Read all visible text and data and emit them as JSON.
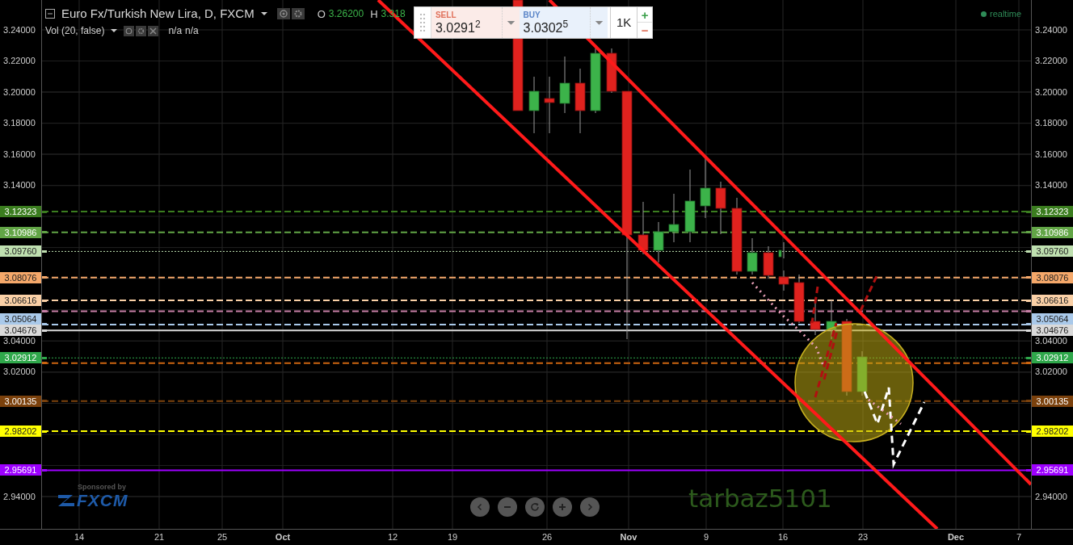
{
  "legend": {
    "title": "Euro Fx/Turkish New Lira, D, FXCM",
    "ohlc": [
      {
        "key": "O",
        "value": "3.26200"
      },
      {
        "key": "H",
        "value": "3.318"
      }
    ]
  },
  "volume_legend": {
    "title": "Vol (20, false)",
    "values": [
      "n/a",
      "n/a"
    ]
  },
  "trade_widget": {
    "sell": {
      "label": "SELL",
      "price": "3.0291$^{2}$"
    },
    "buy": {
      "label": "BUY",
      "price": "3.0302$^{5}$"
    },
    "quantity": "1K",
    "increase": "+",
    "decrease": "−"
  },
  "status": {
    "label": "realtime"
  },
  "left_price_axis": {
    "ticks": [
      "3.24000",
      "3.22000",
      "3.20000",
      "3.18000",
      "3.16000",
      "3.14000",
      "3.04000",
      "3.02000",
      "2.94000"
    ]
  },
  "right_price_axis": {
    "ticks": [
      "3.24000",
      "3.22000",
      "3.20000",
      "3.18000",
      "3.16000",
      "3.14000",
      "3.04000",
      "3.02000",
      "2.94000"
    ]
  },
  "price_levels": [
    {
      "left_label": "3.12323",
      "right_label": "3.12323",
      "color": "#3b7d1f",
      "kind": "dashed"
    },
    {
      "left_label": "3.10986",
      "right_label": "3.10986",
      "color": "#62a546",
      "kind": "dashed"
    },
    {
      "left_label": "3.09760",
      "right_label": "3.09760",
      "color": "#bfe0b0",
      "kind": "dotted"
    },
    {
      "left_label": "3.08076",
      "right_label": "3.08076",
      "color": "#f5a86a",
      "kind": "dashed"
    },
    {
      "left_label": "3.06616",
      "right_label": "3.06616",
      "color": "#fad0a6",
      "kind": "dashed"
    },
    {
      "color": "#c77fa6",
      "kind": "dashed"
    },
    {
      "left_label": "3.05064",
      "right_label": "3.05064",
      "color": "#a9c9ea",
      "kind": "dashed"
    },
    {
      "left_label": "3.04676",
      "right_label": "3.04676",
      "color": "#dadada",
      "kind": "solid"
    },
    {
      "left_label": "3.02912",
      "right_label": "3.02912",
      "color": "#2fa84b",
      "kind": "dotted"
    },
    {
      "color": "#cc6410",
      "kind": "dashed"
    },
    {
      "left_label": "3.00135",
      "right_label": "3.00135",
      "color": "#7b410c",
      "kind": "dashed"
    },
    {
      "left_label": "2.98202",
      "right_label": "2.98202",
      "color": "#ffff00",
      "kind": "dashed"
    },
    {
      "left_label": "2.95691",
      "right_label": "2.95691",
      "color": "#9d00ff",
      "kind": "solid"
    }
  ],
  "time_axis": {
    "labels": [
      "14",
      "21",
      "25",
      "Oct",
      "12",
      "19",
      "26",
      "Nov",
      "9",
      "16",
      "23",
      "Dec",
      "7"
    ]
  },
  "sponsor": {
    "caption": "Sponsored by",
    "brand": "FXCM"
  },
  "annotation": {
    "text": "tarbaz5101"
  }
}
